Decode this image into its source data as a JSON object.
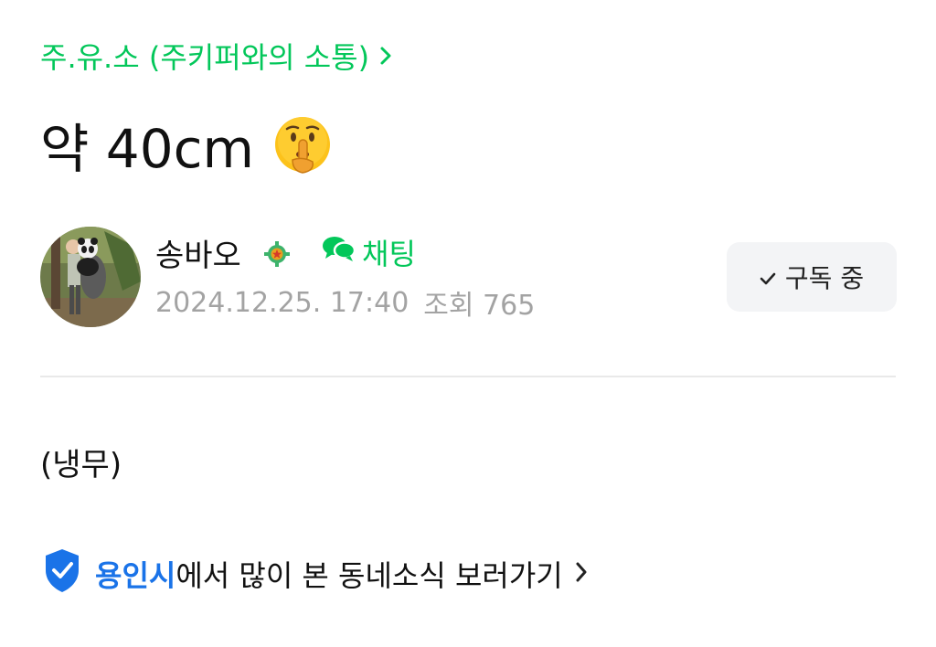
{
  "board": {
    "name": "주.유.소 (주키퍼와의 소통)",
    "chevron_icon": "chevron-right-icon",
    "color": "#03c75a"
  },
  "post": {
    "title": "약 40cm",
    "title_emoji": "shushing-face-emoji",
    "body": "(냉무)"
  },
  "author": {
    "name": "송바오",
    "avatar": "profile-photo-keeper-holding-panda",
    "grade_icon": "member-grade-badge-icon",
    "chat_label": "채팅",
    "chat_icon": "chat-bubbles-icon",
    "date": "2024.12.25. 17:40",
    "views_label": "조회",
    "views_count": "765"
  },
  "subscribe": {
    "label": "구독 중",
    "icon": "check-icon",
    "background": "#f3f4f6"
  },
  "local_news": {
    "region": "용인시",
    "text": "에서 많이 본 동네소식 보러가기",
    "icon": "verified-location-icon",
    "region_color": "#1a73e8"
  }
}
